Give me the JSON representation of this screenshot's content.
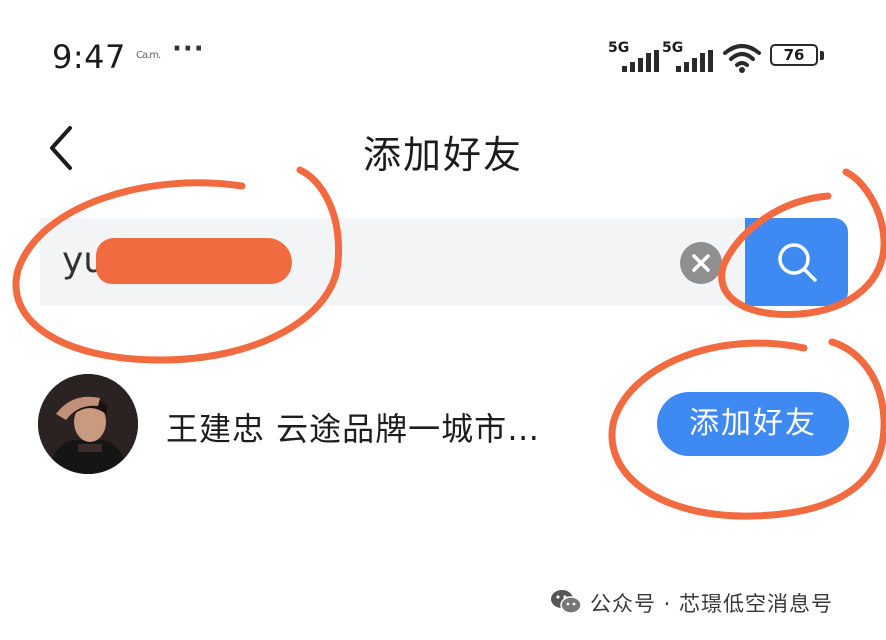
{
  "status_bar": {
    "time": "9:47",
    "mini_text": "Ca.m.",
    "more": "···",
    "network_1": "5G",
    "network_2": "5G",
    "battery": "76"
  },
  "header": {
    "title": "添加好友"
  },
  "search": {
    "query_visible": "yu"
  },
  "result": {
    "name_text": "王建忠  云途品牌一城市…",
    "add_button_label": "添加好友"
  },
  "watermark": {
    "text": "公众号 · 芯璟低空消息号"
  },
  "colors": {
    "accent_blue": "#3f89f2",
    "annotation_orange": "#f26a3f",
    "search_bg": "#f3f4f6"
  },
  "icons": {
    "back": "chevron-left-icon",
    "clear": "close-circle-icon",
    "search": "search-icon",
    "wifi": "wifi-icon",
    "signal": "signal-bars-icon",
    "battery": "battery-icon",
    "wechat": "wechat-icon"
  }
}
